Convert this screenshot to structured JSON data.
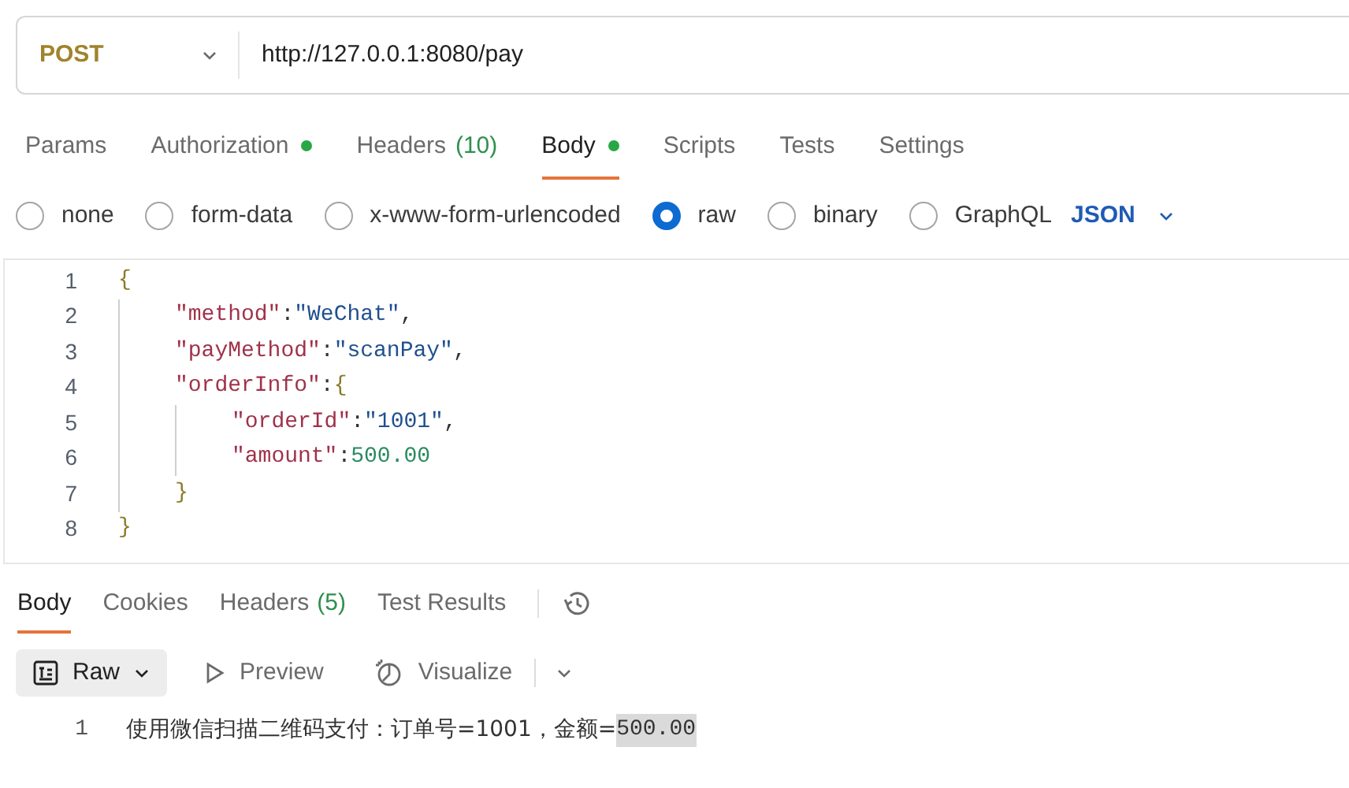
{
  "request": {
    "method": "POST",
    "url": "http://127.0.0.1:8080/pay"
  },
  "tabs": [
    {
      "label": "Params",
      "selected": false,
      "dot": false
    },
    {
      "label": "Authorization",
      "selected": false,
      "dot": true
    },
    {
      "label": "Headers",
      "count": "(10)",
      "selected": false,
      "dot": false
    },
    {
      "label": "Body",
      "selected": true,
      "dot": true
    },
    {
      "label": "Scripts",
      "selected": false,
      "dot": false
    },
    {
      "label": "Tests",
      "selected": false,
      "dot": false
    },
    {
      "label": "Settings",
      "selected": false,
      "dot": false
    }
  ],
  "body_types": [
    {
      "label": "none",
      "selected": false
    },
    {
      "label": "form-data",
      "selected": false
    },
    {
      "label": "x-www-form-urlencoded",
      "selected": false
    },
    {
      "label": "raw",
      "selected": true
    },
    {
      "label": "binary",
      "selected": false
    },
    {
      "label": "GraphQL",
      "selected": false
    }
  ],
  "format": "JSON",
  "editor": {
    "lines": [
      {
        "number": "1",
        "tokens": [
          {
            "kind": "brace",
            "text": "{"
          }
        ]
      },
      {
        "number": "2",
        "tokens": [
          {
            "kind": "key",
            "text": "\"method\""
          },
          {
            "kind": "punct",
            "text": ":"
          },
          {
            "kind": "string",
            "text": "\"WeChat\""
          },
          {
            "kind": "punct",
            "text": ","
          }
        ]
      },
      {
        "number": "3",
        "tokens": [
          {
            "kind": "key",
            "text": "\"payMethod\""
          },
          {
            "kind": "punct",
            "text": ":"
          },
          {
            "kind": "string",
            "text": "\"scanPay\""
          },
          {
            "kind": "punct",
            "text": ","
          }
        ]
      },
      {
        "number": "4",
        "tokens": [
          {
            "kind": "key",
            "text": "\"orderInfo\""
          },
          {
            "kind": "punct",
            "text": ":"
          },
          {
            "kind": "brace",
            "text": "{"
          }
        ]
      },
      {
        "number": "5",
        "tokens": [
          {
            "kind": "key",
            "text": "\"orderId\""
          },
          {
            "kind": "punct",
            "text": ":"
          },
          {
            "kind": "string",
            "text": "\"1001\""
          },
          {
            "kind": "punct",
            "text": ","
          }
        ]
      },
      {
        "number": "6",
        "tokens": [
          {
            "kind": "key",
            "text": "\"amount\""
          },
          {
            "kind": "punct",
            "text": ":"
          },
          {
            "kind": "number",
            "text": "500.00"
          }
        ]
      },
      {
        "number": "7",
        "tokens": [
          {
            "kind": "brace",
            "text": "}"
          }
        ]
      },
      {
        "number": "8",
        "tokens": [
          {
            "kind": "brace",
            "text": "}"
          }
        ]
      }
    ]
  },
  "response_tabs": [
    {
      "label": "Body",
      "selected": true
    },
    {
      "label": "Cookies",
      "selected": false
    },
    {
      "label": "Headers",
      "count": "(5)",
      "selected": false
    },
    {
      "label": "Test Results",
      "selected": false
    }
  ],
  "view_modes": [
    {
      "label": "Raw",
      "selected": true
    },
    {
      "label": "Preview",
      "selected": false
    },
    {
      "label": "Visualize",
      "selected": false
    }
  ],
  "response_lines": [
    {
      "number": "1",
      "segments": [
        {
          "text": "使用微信扫描二维码支付：订单号=1001，金额=",
          "selected": false
        },
        {
          "text": "500.00",
          "selected": true
        }
      ]
    }
  ]
}
